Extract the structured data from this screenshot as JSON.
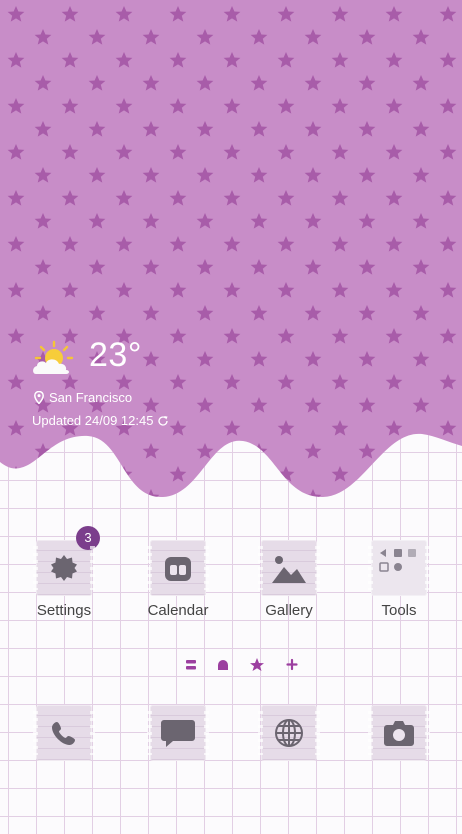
{
  "colors": {
    "wallpaper": "#c88dc8",
    "star": "#a85ca9",
    "accent": "#9c3fa0",
    "grid_line": "#e2cfe4",
    "tile": "#e6dce8",
    "icon_glyph": "#6b6570",
    "badge": "#7b3e8c"
  },
  "weather": {
    "icon": "sun-behind-cloud-icon",
    "temperature": "23°",
    "location": "San Francisco",
    "updated": "Updated 24/09 12:45"
  },
  "apps": [
    {
      "label": "Settings",
      "icon": "gear-icon",
      "badge": "3"
    },
    {
      "label": "Calendar",
      "icon": "calendar-icon"
    },
    {
      "label": "Gallery",
      "icon": "image-icon"
    },
    {
      "label": "Tools",
      "icon": "tools-folder-icon"
    }
  ],
  "page_indicator": {
    "pages": [
      "menu-icon",
      "home-icon",
      "star-icon",
      "plus-icon"
    ],
    "current_page": 2
  },
  "dock": [
    {
      "icon": "phone-icon"
    },
    {
      "icon": "message-icon"
    },
    {
      "icon": "browser-globe-icon"
    },
    {
      "icon": "camera-icon"
    }
  ]
}
